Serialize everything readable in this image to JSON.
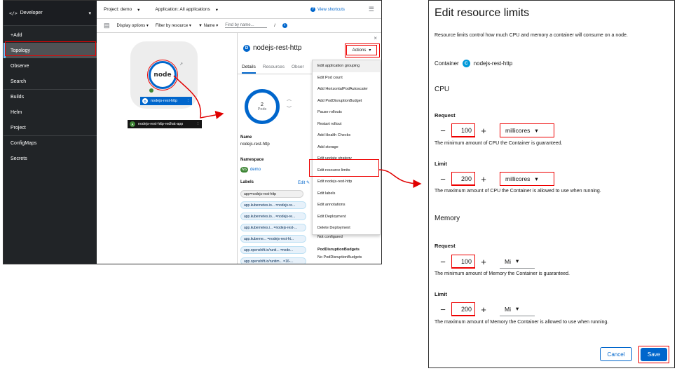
{
  "console": {
    "perspective": {
      "icon": "</>",
      "label": "Developer"
    },
    "nav": [
      {
        "label": "+Add"
      },
      {
        "label": "Topology"
      },
      {
        "label": "Observe"
      },
      {
        "label": "Search"
      },
      {
        "label": "Builds"
      },
      {
        "label": "Helm"
      },
      {
        "label": "Project"
      },
      {
        "label": "ConfigMaps"
      },
      {
        "label": "Secrets"
      }
    ],
    "topbar": {
      "project": "Project: demo",
      "application": "Application: All applications",
      "view_shortcuts": "View shortcuts"
    },
    "filterbar": {
      "display_options": "Display options",
      "filter_by_resource": "Filter by resource",
      "name_filter": "Name",
      "find_placeholder": "Find by name...",
      "slash": "/"
    },
    "graph": {
      "node_logo": "node",
      "node_badge_icon": "D",
      "node_badge": "nodejs-rest-http",
      "app_badge_icon": "A",
      "app_badge": "nodejs-rest-http-redhat-app"
    },
    "panel": {
      "icon": "D",
      "title": "nodejs-rest-http",
      "actions": "Actions",
      "tabs": [
        "Details",
        "Resources",
        "Obser"
      ],
      "pods_count": "2",
      "pods_label": "Pods",
      "name_label": "Name",
      "name_value": "nodejs-rest-http",
      "namespace_label": "Namespace",
      "namespace_badge": "NS",
      "namespace_value": "demo",
      "labels_label": "Labels",
      "labels_edit": "Edit",
      "labels": [
        "app=nodejs-rest-http",
        "app.kubernetes.io... =nodejs-re...",
        "app.kubernetes.io... =nodejs-re...",
        "app.kubernetes.i... =nodejs-rest-...",
        "app.kuberne... =nodejs-rest-ht...",
        "app.openshift.io/runti... =node...",
        "app.openshift.io/runtim... =16-..."
      ],
      "not_configured": "Not configured",
      "pdb_label": "PodDisruptionBudgets",
      "pdb_value": "No PodDisruptionBudgets"
    },
    "menu": [
      "Edit application grouping",
      "Edit Pod count",
      "Add HorizontalPodAutoscaler",
      "Add PodDisruptionBudget",
      "Pause rollouts",
      "Restart rollout",
      "Add Health Checks",
      "Add storage",
      "Edit update strategy",
      "Edit resource limits",
      "Edit nodejs-rest-http",
      "Edit labels",
      "Edit annotations",
      "Edit Deployment",
      "Delete Deployment"
    ]
  },
  "form": {
    "title": "Edit resource limits",
    "description": "Resource limits control how much CPU and memory a container will consume on a node.",
    "container_label": "Container",
    "container_icon": "C",
    "container_name": "nodejs-rest-http",
    "cpu": {
      "heading": "CPU",
      "request_label": "Request",
      "request_value": "100",
      "request_unit": "millicores",
      "request_helper": "The minimum amount of CPU the Container is guaranteed.",
      "limit_label": "Limit",
      "limit_value": "200",
      "limit_unit": "millicores",
      "limit_helper": "The maximum amount of CPU the Container is allowed to use when running."
    },
    "memory": {
      "heading": "Memory",
      "request_label": "Request",
      "request_value": "100",
      "request_unit": "Mi",
      "request_helper": "The minimum amount of Memory the Container is guaranteed.",
      "limit_label": "Limit",
      "limit_value": "200",
      "limit_unit": "Mi",
      "limit_helper": "The maximum amount of Memory the Container is allowed to use when running."
    },
    "minus": "−",
    "plus": "+",
    "cancel": "Cancel",
    "save": "Save"
  },
  "colors": {
    "accent": "#0066cc",
    "highlight": "#e00000",
    "sidebar": "#212427",
    "success": "#3e8635"
  },
  "icons": [
    "caret-down-icon",
    "help-icon",
    "filter-icon",
    "info-icon",
    "close-icon",
    "chevron-up-icon",
    "chevron-down-icon",
    "pencil-icon",
    "external-link-icon",
    "check-icon",
    "topology-list-icon",
    "display-options-icon"
  ]
}
